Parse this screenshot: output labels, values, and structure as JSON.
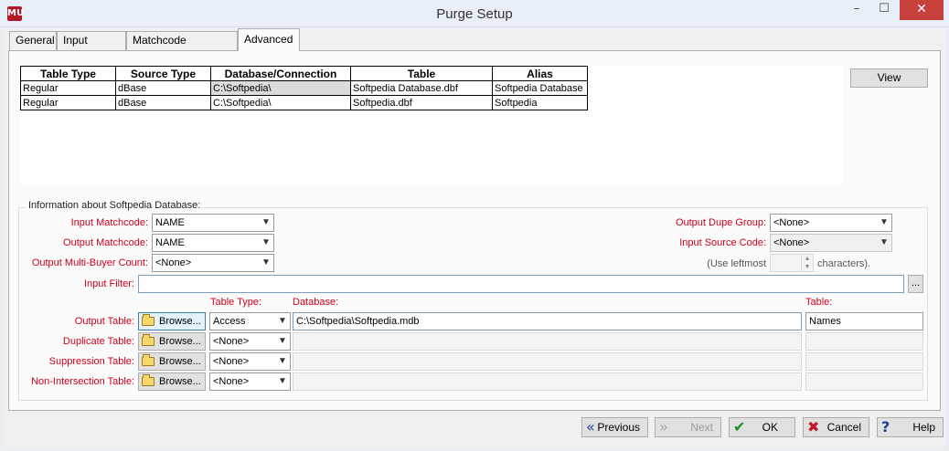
{
  "window": {
    "title": "Purge Setup",
    "icon_text": "MU",
    "minimize": "–",
    "maximize": "☐",
    "close": "✕"
  },
  "tabs": [
    {
      "label": "General"
    },
    {
      "label": "Input Tables"
    },
    {
      "label": "Matchcode Mapping"
    },
    {
      "label": "Advanced"
    }
  ],
  "grid": {
    "headers": [
      "Table Type",
      "Source Type",
      "Database/Connection",
      "Table",
      "Alias"
    ],
    "rows": [
      [
        "Regular",
        "dBase",
        "C:\\Softpedia\\",
        "Softpedia Database.dbf",
        "Softpedia Database"
      ],
      [
        "Regular",
        "dBase",
        "C:\\Softpedia\\",
        "Softpedia.dbf",
        "Softpedia"
      ]
    ],
    "view_button": "View"
  },
  "info": {
    "group_label": "Information about Softpedia Database:",
    "input_matchcode": {
      "label": "Input Matchcode:",
      "value": "NAME"
    },
    "output_matchcode": {
      "label": "Output Matchcode:",
      "value": "NAME"
    },
    "output_multibuyer": {
      "label": "Output Multi-Buyer Count:",
      "value": "<None>"
    },
    "output_dupe_group": {
      "label": "Output Dupe Group:",
      "value": "<None>"
    },
    "input_source_code": {
      "label": "Input Source Code:",
      "value": "<None>"
    },
    "leftmost_prefix": "(Use leftmost",
    "leftmost_suffix": "characters).",
    "input_filter": {
      "label": "Input Filter:",
      "value": "",
      "ellipsis": "..."
    },
    "col_table_type": "Table Type:",
    "col_database": "Database:",
    "col_table": "Table:",
    "browse_label": "Browse...",
    "output_table": {
      "label": "Output Table:",
      "type": "Access",
      "database": "C:\\Softpedia\\Softpedia.mdb",
      "table": "Names"
    },
    "duplicate_table": {
      "label": "Duplicate Table:",
      "type": "<None>"
    },
    "suppression_table": {
      "label": "Suppression Table:",
      "type": "<None>"
    },
    "nonintersection_table": {
      "label": "Non-Intersection Table:",
      "type": "<None>"
    }
  },
  "buttons": {
    "previous": "Previous",
    "next": "Next",
    "ok": "OK",
    "cancel": "Cancel",
    "help": "Help"
  }
}
